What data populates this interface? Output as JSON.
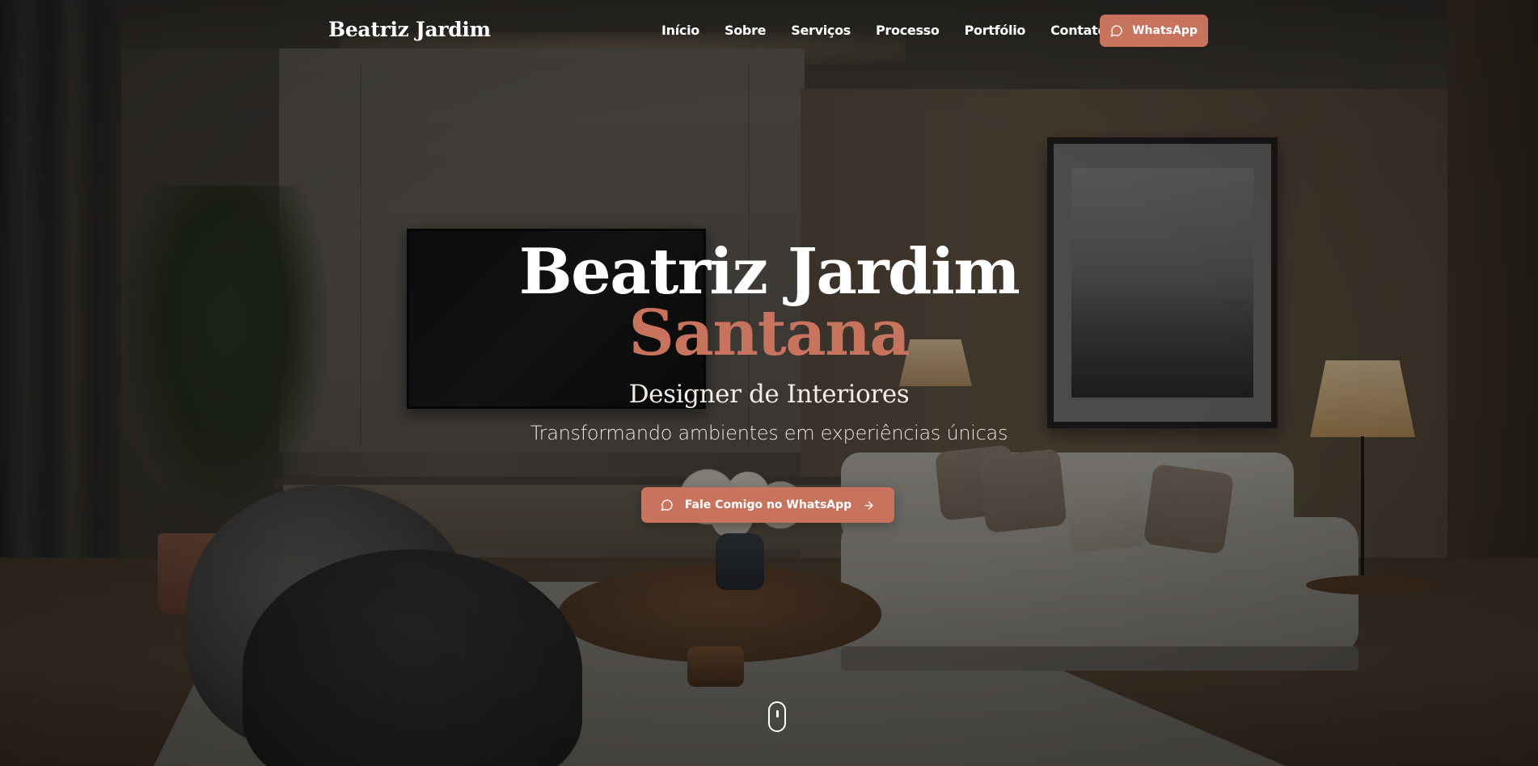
{
  "brand": {
    "name": "Beatriz Jardim"
  },
  "nav": {
    "items": [
      {
        "label": "Início"
      },
      {
        "label": "Sobre"
      },
      {
        "label": "Serviços"
      },
      {
        "label": "Processo"
      },
      {
        "label": "Portfólio"
      },
      {
        "label": "Contato"
      }
    ],
    "cta": {
      "label": "WhatsApp",
      "icon": "chat-bubble-icon"
    }
  },
  "hero": {
    "title_line1": "Beatriz Jardim",
    "title_line2": "Santana",
    "role": "Designer de Interiores",
    "tagline": "Transformando ambientes em experiências únicas",
    "cta": {
      "label": "Fale Comigo no WhatsApp",
      "icon": "chat-bubble-icon",
      "trailing_icon": "arrow-right-icon"
    },
    "scroll_indicator_icon": "mouse-scroll-icon",
    "background_description_icon": "room-photo"
  },
  "colors": {
    "accent": "#c8735e",
    "text_primary": "#ffffff",
    "overlay": "rgba(0,0,0,0.38)"
  }
}
